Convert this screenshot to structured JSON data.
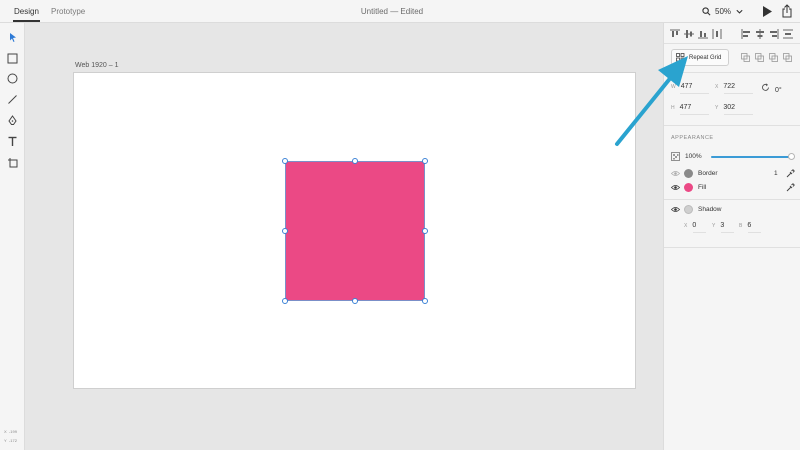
{
  "topbar": {
    "tabs": [
      {
        "label": "Design",
        "active": true
      },
      {
        "label": "Prototype",
        "active": false
      }
    ],
    "document_title": "Untitled — Edited",
    "zoom": "50%"
  },
  "toolbar": {
    "tools": [
      "select-icon",
      "rectangle-icon",
      "ellipse-icon",
      "line-icon",
      "pen-icon",
      "text-icon",
      "artboard-icon"
    ],
    "coords": {
      "x_label": "X",
      "x_value": "-199",
      "y_label": "Y",
      "y_value": "-172"
    }
  },
  "canvas": {
    "artboard_label": "Web 1920 – 1",
    "shape_fill": "#eb4985"
  },
  "panel": {
    "repeat_grid_label": "Repeat Grid",
    "props": {
      "w_label": "W",
      "w": "477",
      "x_label": "X",
      "x": "722",
      "rotation": "0°",
      "h_label": "H",
      "h": "477",
      "y_label": "Y",
      "y": "302"
    },
    "appearance_title": "APPEARANCE",
    "opacity": "100%",
    "opacity_fraction": 1.0,
    "border": {
      "label": "Border",
      "width": "1",
      "color": "#8a8a8a"
    },
    "fill": {
      "label": "Fill",
      "color": "#eb4985"
    },
    "shadow": {
      "label": "Shadow",
      "x_label": "X",
      "x": "0",
      "y_label": "Y",
      "y": "3",
      "b_label": "B",
      "b": "6",
      "color": "#cfcfcf"
    }
  },
  "colors": {
    "accent": "#3b82d6",
    "annotation_arrow": "#2aa3cf"
  }
}
